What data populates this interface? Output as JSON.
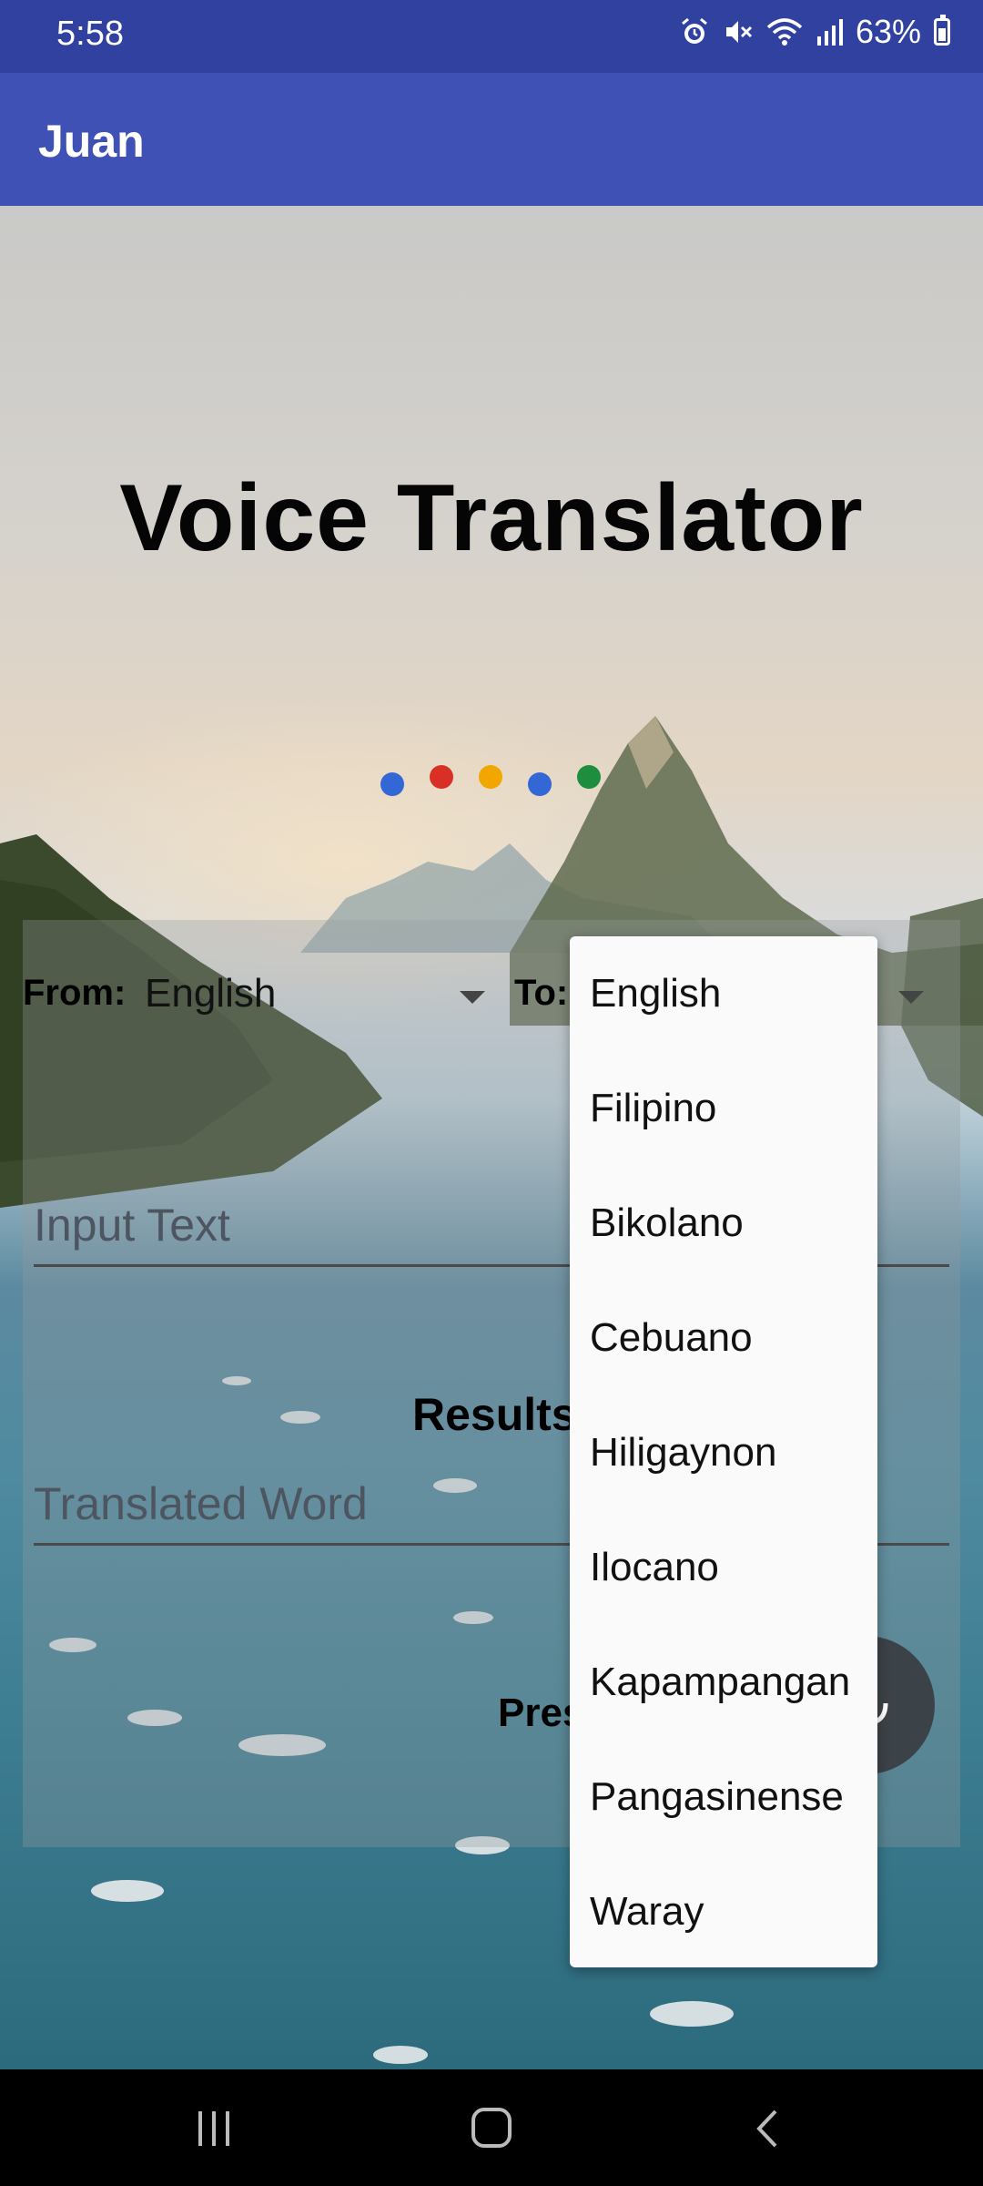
{
  "status_bar": {
    "time": "5:58",
    "battery_text": "63%",
    "icons": [
      "alarm-icon",
      "mute-icon",
      "wifi-icon",
      "signal-icon",
      "battery-icon"
    ]
  },
  "app_bar": {
    "title": "Juan"
  },
  "main": {
    "title": "Voice Translator",
    "dots_colors": [
      "#3367d6",
      "#d93025",
      "#f2a600",
      "#3367d6",
      "#1e8e3e"
    ]
  },
  "form": {
    "from_label": "From:",
    "from_value": "English",
    "to_label": "To:",
    "input_placeholder": "Input Text",
    "results_label": "Results",
    "output_placeholder": "Translated Word",
    "press_label": "Pres"
  },
  "dropdown": {
    "options": [
      "English",
      "Filipino",
      "Bikolano",
      "Cebuano",
      "Hiligaynon",
      "Ilocano",
      "Kapampangan",
      "Pangasinense",
      "Waray"
    ]
  },
  "colors": {
    "status_bar": "#3041a0",
    "app_bar": "#3f51b5"
  }
}
